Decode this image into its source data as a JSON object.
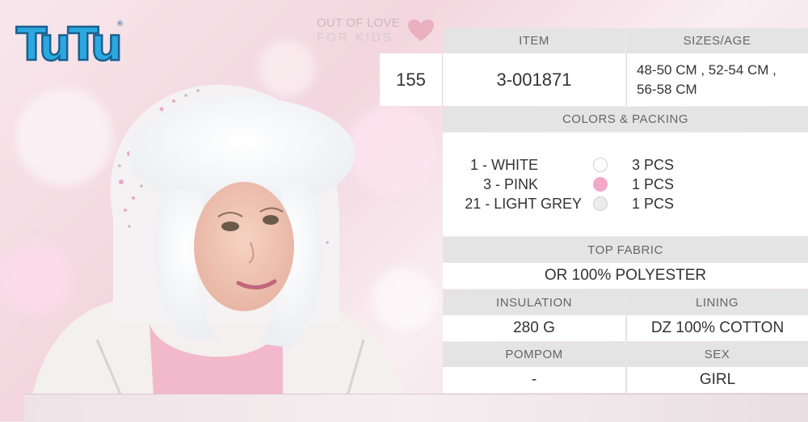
{
  "brand": {
    "logo_text": "TuTu",
    "tagline_line1": "OUT OF LOVE",
    "tagline_line2": "FOR KIDS",
    "heart_color": "#e9aebf",
    "logo_color": "#29a9df"
  },
  "product": {
    "number": "155",
    "item_header": "ITEM",
    "item_value": "3-001871",
    "sizes_header": "SIZES/AGE",
    "sizes_value_line1": "48-50 CM , 52-54 CM ,",
    "sizes_value_line2": "56-58 CM",
    "colors_header": "COLORS & PACKING",
    "colors": [
      {
        "name": "1 - WHITE",
        "swatch": "#ffffff",
        "qty": "3 PCS"
      },
      {
        "name": "3 - PINK",
        "swatch": "#f2a8c9",
        "qty": "1 PCS"
      },
      {
        "name": "21 - LIGHT GREY",
        "swatch": "#ececec",
        "qty": "1 PCS"
      }
    ],
    "top_fabric_header": "TOP FABRIC",
    "top_fabric_value": "OR 100% POLYESTER",
    "insulation_header": "INSULATION",
    "insulation_value": "280 G",
    "lining_header": "LINING",
    "lining_value": "DZ 100% COTTON",
    "pompom_header": "POMPOM",
    "pompom_value": "-",
    "sex_header": "SEX",
    "sex_value": "GIRL"
  }
}
